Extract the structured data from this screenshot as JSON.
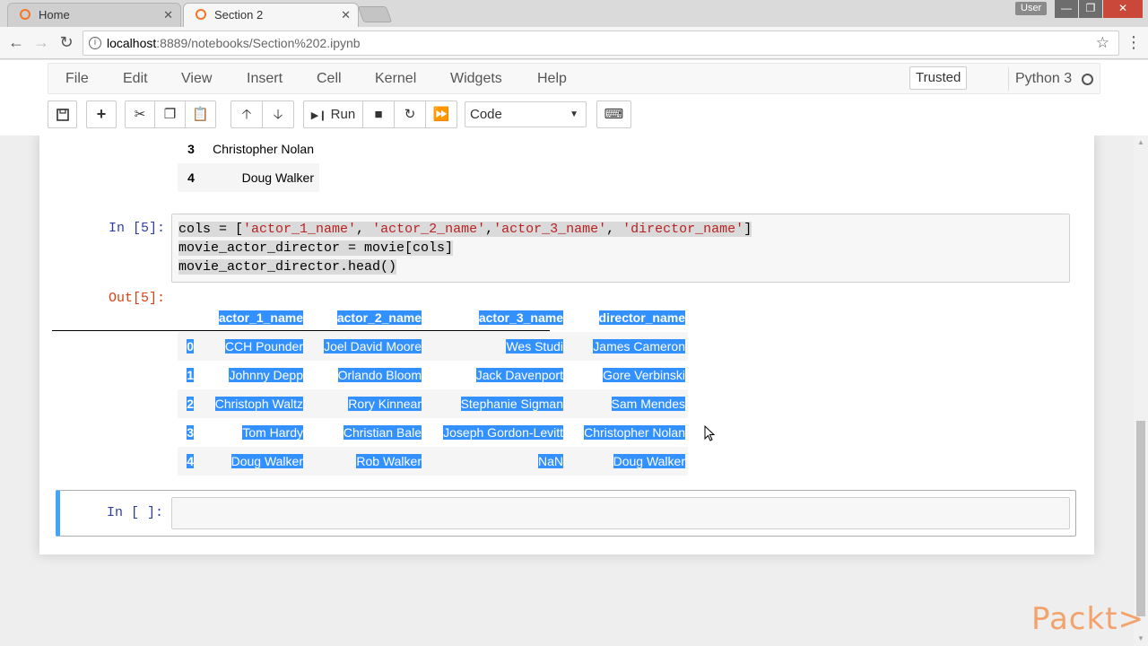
{
  "browser": {
    "tabs": [
      {
        "title": "Home",
        "icon": "jupyter-icon",
        "close": "✕"
      },
      {
        "title": "Section 2",
        "icon": "jupyter-icon",
        "close": "✕"
      }
    ],
    "user_badge": "User",
    "url_host": "localhost",
    "url_path": ":8889/notebooks/Section%202.ipynb"
  },
  "jupyter": {
    "menu": [
      "File",
      "Edit",
      "View",
      "Insert",
      "Cell",
      "Kernel",
      "Widgets",
      "Help"
    ],
    "trusted": "Trusted",
    "kernel": "Python 3",
    "toolbar": {
      "run_label": "Run",
      "cell_type": "Code"
    }
  },
  "prev_output": {
    "rows": [
      {
        "idx": "3",
        "value": "Christopher Nolan"
      },
      {
        "idx": "4",
        "value": "Doug Walker"
      }
    ]
  },
  "cell5": {
    "in_prompt": "In [5]:",
    "out_prompt": "Out[5]:",
    "code": {
      "l1_a": "cols = [",
      "s1": "'actor_1_name'",
      "c1": ", ",
      "s2": "'actor_2_name'",
      "c2": ",",
      "s3": "'actor_3_name'",
      "c3": ", ",
      "s4": "'director_name'",
      "l1_end": "]",
      "l2": "movie_actor_director = movie[cols]",
      "l3": "movie_actor_director.head()"
    },
    "dataframe": {
      "columns": [
        "actor_1_name",
        "actor_2_name",
        "actor_3_name",
        "director_name"
      ],
      "rows": [
        {
          "idx": "0",
          "cells": [
            "CCH Pounder",
            "Joel David Moore",
            "Wes Studi",
            "James Cameron"
          ]
        },
        {
          "idx": "1",
          "cells": [
            "Johnny Depp",
            "Orlando Bloom",
            "Jack Davenport",
            "Gore Verbinski"
          ]
        },
        {
          "idx": "2",
          "cells": [
            "Christoph Waltz",
            "Rory Kinnear",
            "Stephanie Sigman",
            "Sam Mendes"
          ]
        },
        {
          "idx": "3",
          "cells": [
            "Tom Hardy",
            "Christian Bale",
            "Joseph Gordon-Levitt",
            "Christopher Nolan"
          ]
        },
        {
          "idx": "4",
          "cells": [
            "Doug Walker",
            "Rob Walker",
            "NaN",
            "Doug Walker"
          ]
        }
      ]
    },
    "selection_color": "#3390ff"
  },
  "new_cell": {
    "in_prompt": "In [ ]:"
  },
  "watermark": "Packt>"
}
